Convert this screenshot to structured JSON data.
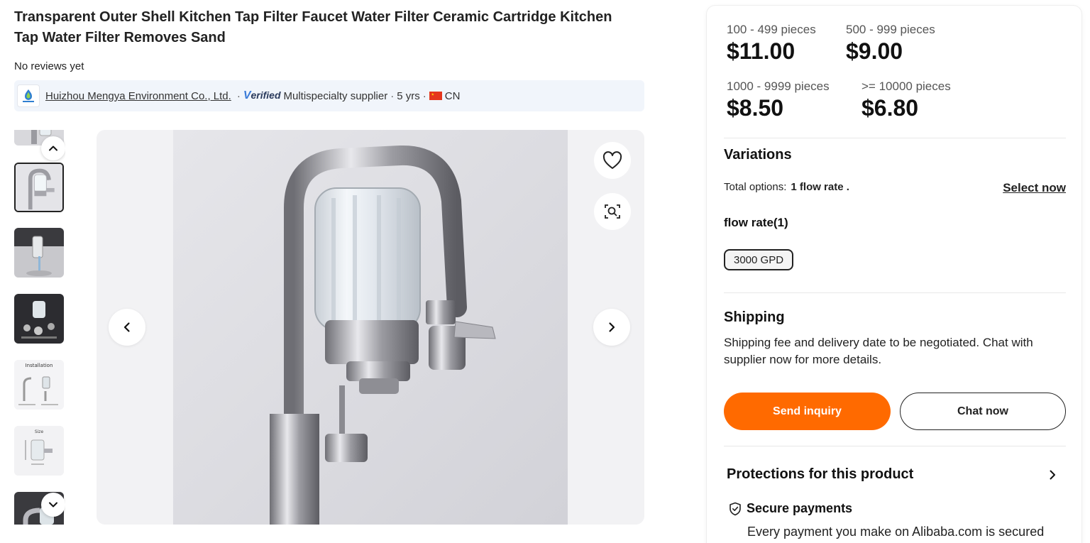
{
  "product": {
    "title": "Transparent Outer Shell Kitchen Tap Filter Faucet Water Filter Ceramic Cartridge Kitchen Tap Water Filter Removes Sand",
    "reviews": "No reviews yet"
  },
  "supplier": {
    "name": "Huizhou Mengya Environment Co., Ltd.",
    "separator": "·",
    "verified_v": "V",
    "verified_rest": "erified",
    "type": "Multispecialty supplier",
    "years": "5 yrs",
    "country": "CN",
    "logo_icon": "mengya-logo-icon"
  },
  "gallery": {
    "thumb_count": 7,
    "active_index": 1,
    "thumbs": [
      {
        "name": "thumb-partial-top"
      },
      {
        "name": "thumb-faucet-closeup"
      },
      {
        "name": "thumb-sink-dark"
      },
      {
        "name": "thumb-parts-exploded"
      },
      {
        "name": "thumb-installation",
        "label": "Installation"
      },
      {
        "name": "thumb-size",
        "label": "Size"
      },
      {
        "name": "thumb-partial-bottom"
      }
    ],
    "icons": {
      "up": "chevron-up-icon",
      "down": "chevron-down-icon",
      "prev": "chevron-left-icon",
      "next": "chevron-right-icon",
      "favorite": "heart-icon",
      "image_search": "image-search-icon"
    }
  },
  "pricing": {
    "tiers": [
      {
        "range": "100 - 499 pieces",
        "price": "$11.00"
      },
      {
        "range": "500 - 999 pieces",
        "price": "$9.00"
      },
      {
        "range": "1000 - 9999 pieces",
        "price": "$8.50"
      },
      {
        "range": ">= 10000 pieces",
        "price": "$6.80"
      }
    ]
  },
  "variations": {
    "heading": "Variations",
    "total_label": "Total options:",
    "total_value": "1 flow rate .",
    "select_now": "Select now",
    "flow_label": "flow rate(1)",
    "options": [
      "3000 GPD"
    ]
  },
  "shipping": {
    "heading": "Shipping",
    "text": "Shipping fee and delivery date to be negotiated. Chat with supplier now for more details."
  },
  "actions": {
    "send_inquiry": "Send inquiry",
    "chat_now": "Chat now",
    "primary_color": "#ff6a00"
  },
  "protections": {
    "heading": "Protections for this product",
    "secure_title": "Secure payments",
    "secure_desc": "Every payment you make on Alibaba.com is secured"
  }
}
